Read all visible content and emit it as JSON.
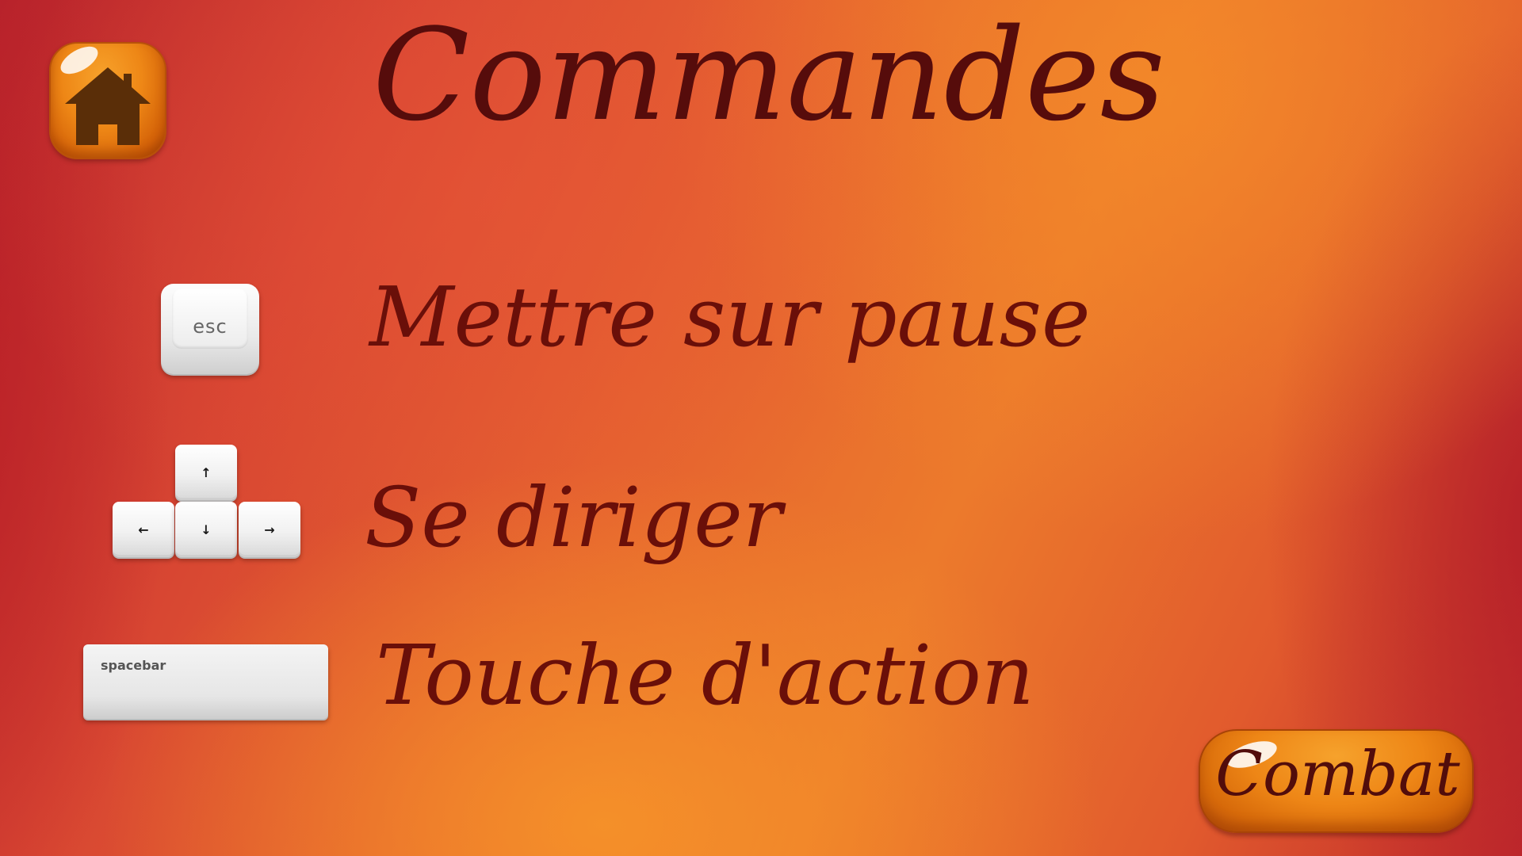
{
  "screen": {
    "title": "Commandes"
  },
  "home_button": {
    "icon": "home-icon",
    "color": "#ee8716",
    "icon_color": "#5a2e08"
  },
  "commands": [
    {
      "key": "esc",
      "description": "Mettre sur pause"
    },
    {
      "key": "arrows",
      "description": "Se diriger",
      "arrows": [
        "↑",
        "←",
        "↓",
        "→"
      ]
    },
    {
      "key": "spacebar",
      "description": "Touche d'action"
    }
  ],
  "combat_button": {
    "label": "Combat",
    "color": "#ee8616"
  },
  "colors": {
    "text": "#6a0f09",
    "title": "#560c0b",
    "background_warm": "#ec7a2c",
    "background_red": "#b8232c"
  }
}
